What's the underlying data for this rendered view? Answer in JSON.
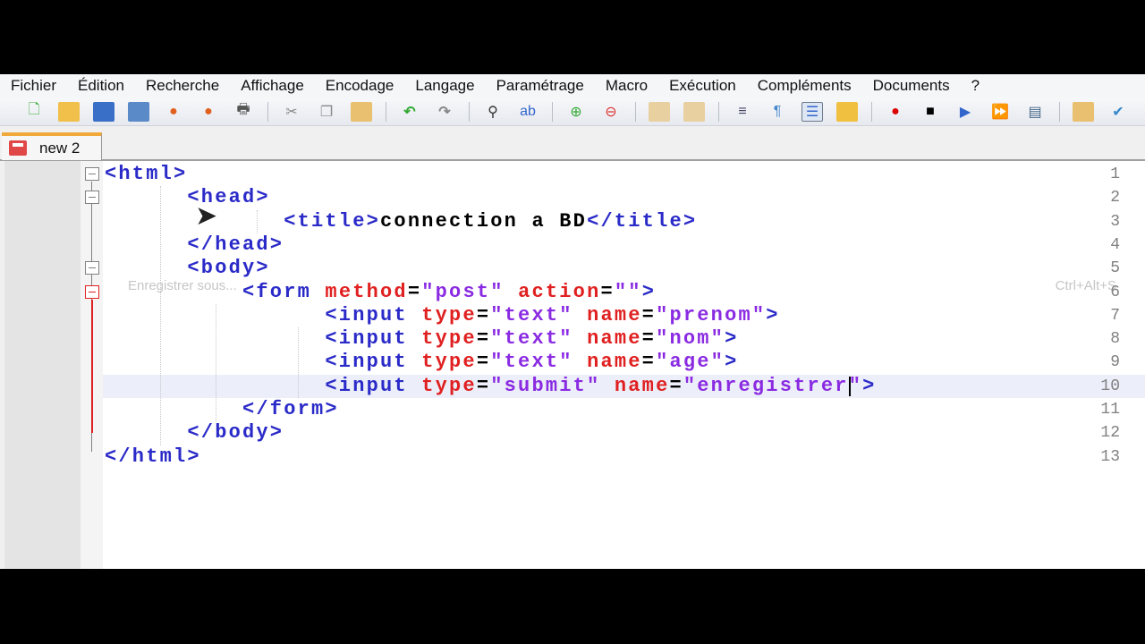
{
  "menu": [
    "Fichier",
    "Édition",
    "Recherche",
    "Affichage",
    "Encodage",
    "Langage",
    "Paramétrage",
    "Macro",
    "Exécution",
    "Compléments",
    "Documents",
    "?"
  ],
  "tab": {
    "label": "new 2"
  },
  "ghost_menu": {
    "label": "Enregistrer sous...",
    "shortcut": "Ctrl+Alt+S"
  },
  "line_numbers": [
    "1",
    "2",
    "3",
    "4",
    "5",
    "6",
    "7",
    "8",
    "9",
    "10",
    "11",
    "12",
    "13"
  ],
  "current_line": 10,
  "code": [
    [
      [
        "tag",
        "<html>"
      ]
    ],
    [
      [
        "tag",
        "<head>"
      ]
    ],
    [
      [
        "tag",
        "<title>"
      ],
      [
        "txt",
        "connection a BD"
      ],
      [
        "tag",
        "</title>"
      ]
    ],
    [
      [
        "tag",
        "</head>"
      ]
    ],
    [
      [
        "tag",
        "<body>"
      ]
    ],
    [
      [
        "tag",
        "<form "
      ],
      [
        "attr",
        "method"
      ],
      [
        "txt",
        "="
      ],
      [
        "val",
        "\"post\""
      ],
      [
        "txt",
        " "
      ],
      [
        "attr",
        "action"
      ],
      [
        "txt",
        "="
      ],
      [
        "val",
        "\"\""
      ],
      [
        "tag",
        ">"
      ]
    ],
    [
      [
        "tag",
        "<input "
      ],
      [
        "attr",
        "type"
      ],
      [
        "txt",
        "="
      ],
      [
        "val",
        "\"text\""
      ],
      [
        "txt",
        " "
      ],
      [
        "attr",
        "name"
      ],
      [
        "txt",
        "="
      ],
      [
        "val",
        "\"prenom\""
      ],
      [
        "tag",
        ">"
      ]
    ],
    [
      [
        "tag",
        "<input "
      ],
      [
        "attr",
        "type"
      ],
      [
        "txt",
        "="
      ],
      [
        "val",
        "\"text\""
      ],
      [
        "txt",
        " "
      ],
      [
        "attr",
        "name"
      ],
      [
        "txt",
        "="
      ],
      [
        "val",
        "\"nom\""
      ],
      [
        "tag",
        ">"
      ]
    ],
    [
      [
        "tag",
        "<input "
      ],
      [
        "attr",
        "type"
      ],
      [
        "txt",
        "="
      ],
      [
        "val",
        "\"text\""
      ],
      [
        "txt",
        " "
      ],
      [
        "attr",
        "name"
      ],
      [
        "txt",
        "="
      ],
      [
        "val",
        "\"age\""
      ],
      [
        "tag",
        ">"
      ]
    ],
    [
      [
        "tag",
        "<input "
      ],
      [
        "attr",
        "type"
      ],
      [
        "txt",
        "="
      ],
      [
        "val",
        "\"submit\""
      ],
      [
        "txt",
        " "
      ],
      [
        "attr",
        "name"
      ],
      [
        "txt",
        "="
      ],
      [
        "val",
        "\"enregistrer\""
      ],
      [
        "tag",
        ">"
      ]
    ],
    [
      [
        "tag",
        "</form>"
      ]
    ],
    [
      [
        "tag",
        "</body>"
      ]
    ],
    [
      [
        "tag",
        "</html>"
      ]
    ]
  ]
}
